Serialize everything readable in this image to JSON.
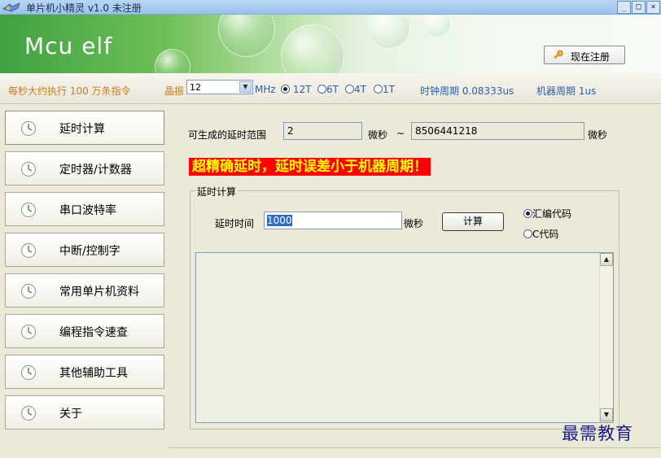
{
  "window": {
    "title": "单片机小精灵 v1.0 未注册",
    "controls": [
      "_",
      "□",
      "×"
    ]
  },
  "banner": {
    "logo": "Mcu elf",
    "register_label": "现在注册"
  },
  "infobar": {
    "speed_text": "每秒大约执行 100 万条指令",
    "crystal_label": "晶振",
    "crystal_value": "12",
    "mhz_label": "MHz",
    "modes": [
      {
        "label": "12T",
        "selected": true
      },
      {
        "label": "6T",
        "selected": false
      },
      {
        "label": "4T",
        "selected": false
      },
      {
        "label": "1T",
        "selected": false
      }
    ],
    "clock_period": "时钟周期 0.08333us",
    "machine_period": "机器周期 1us"
  },
  "sidebar": {
    "items": [
      {
        "label": "延时计算",
        "active": true
      },
      {
        "label": "定时器/计数器",
        "active": false
      },
      {
        "label": "串口波特率",
        "active": false
      },
      {
        "label": "中断/控制字",
        "active": false
      },
      {
        "label": "常用单片机资料",
        "active": false
      },
      {
        "label": "编程指令速查",
        "active": false
      },
      {
        "label": "其他辅助工具",
        "active": false
      },
      {
        "label": "关于",
        "active": false
      }
    ]
  },
  "main": {
    "range_label": "可生成的延时范围",
    "range_min": "2",
    "unit_us": "微秒",
    "tilde": "~",
    "range_max": "8506441218",
    "headline": "超精确延时，延时误差小于机器周期！",
    "group_title": "延时计算",
    "delay_label": "延时时间",
    "delay_value": "1000",
    "calc_label": "计算",
    "lang_options": [
      {
        "label": "汇编代码",
        "selected": true
      },
      {
        "label": "C代码",
        "selected": false
      }
    ],
    "output_text": ""
  },
  "watermark": "最需教育",
  "colors": {
    "banner_green": "#3fa142",
    "headline_bg": "#ff0000",
    "headline_fg": "#ffff00",
    "info_orange": "#c87b20",
    "info_blue": "#2a5fa8"
  }
}
